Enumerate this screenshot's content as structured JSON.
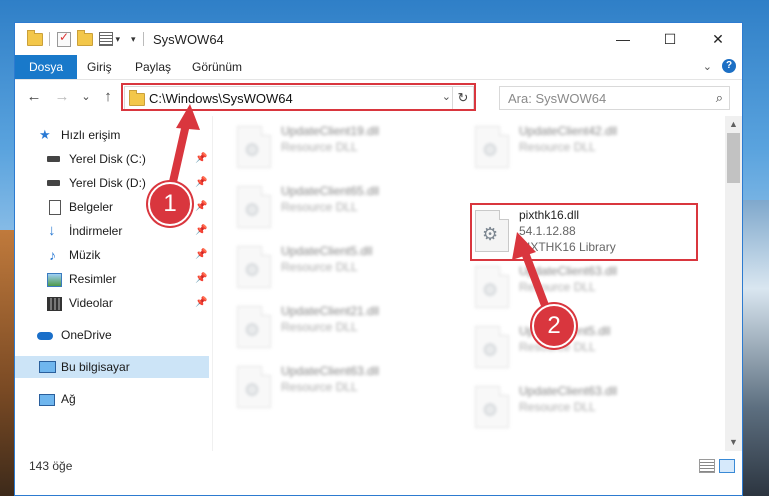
{
  "window": {
    "title": "SysWOW64",
    "controls": {
      "minimize": "—",
      "maximize": "☐",
      "close": "✕"
    }
  },
  "ribbon": {
    "tabs": [
      {
        "label": "Dosya"
      },
      {
        "label": "Giriş"
      },
      {
        "label": "Paylaş"
      },
      {
        "label": "Görünüm"
      }
    ],
    "help": "?"
  },
  "nav": {
    "back": "←",
    "forward": "→",
    "recent": "⌄",
    "up": "↑",
    "address": "C:\\Windows\\SysWOW64",
    "refresh": "↻",
    "search_placeholder": "Ara: SysWOW64"
  },
  "sidebar": {
    "items": [
      {
        "label": "Hızlı erişim",
        "icon": "star-icon",
        "pinned": false
      },
      {
        "label": "Yerel Disk (C:)",
        "icon": "drive-icon",
        "pinned": true
      },
      {
        "label": "Yerel Disk (D:)",
        "icon": "drive-icon",
        "pinned": true
      },
      {
        "label": "Belgeler",
        "icon": "documents-icon",
        "pinned": true
      },
      {
        "label": "İndirmeler",
        "icon": "downloads-icon",
        "pinned": true
      },
      {
        "label": "Müzik",
        "icon": "music-icon",
        "pinned": true
      },
      {
        "label": "Resimler",
        "icon": "pictures-icon",
        "pinned": true
      },
      {
        "label": "Videolar",
        "icon": "videos-icon",
        "pinned": true
      },
      {
        "label": "OneDrive",
        "icon": "cloud-icon",
        "pinned": false
      },
      {
        "label": "Bu bilgisayar",
        "icon": "computer-icon",
        "pinned": false,
        "selected": true
      },
      {
        "label": "Ağ",
        "icon": "network-icon",
        "pinned": false
      }
    ]
  },
  "files": {
    "left_column": [
      {
        "name": "UpdateClient19.dll",
        "type": "Resource DLL"
      },
      {
        "name": "UpdateClient65.dll",
        "type": "Resource DLL"
      },
      {
        "name": "UpdateClient5.dll",
        "type": "Resource DLL"
      },
      {
        "name": "UpdateClient21.dll",
        "type": "Resource DLL"
      },
      {
        "name": "UpdateClient63.dll",
        "type": "Resource DLL"
      }
    ],
    "right_column": [
      {
        "name": "UpdateClient42.dll",
        "type": "Resource DLL"
      },
      {
        "name": "pixthk16.dll",
        "version": "54.1.12.88",
        "type": "PIXTHK16 Library",
        "highlighted": true
      },
      {
        "name": "UpdateClient63.dll",
        "type": "Resource DLL"
      },
      {
        "name": "UpdateClient5.dll",
        "type": "Resource DLL"
      },
      {
        "name": "UpdateClient63.dll",
        "type": "Resource DLL"
      }
    ]
  },
  "status": {
    "item_count": "143 öğe"
  },
  "callouts": [
    {
      "number": "1"
    },
    {
      "number": "2"
    }
  ],
  "colors": {
    "accent": "#1979ca",
    "highlight": "#d9363e",
    "selected": "#cce4f7"
  }
}
